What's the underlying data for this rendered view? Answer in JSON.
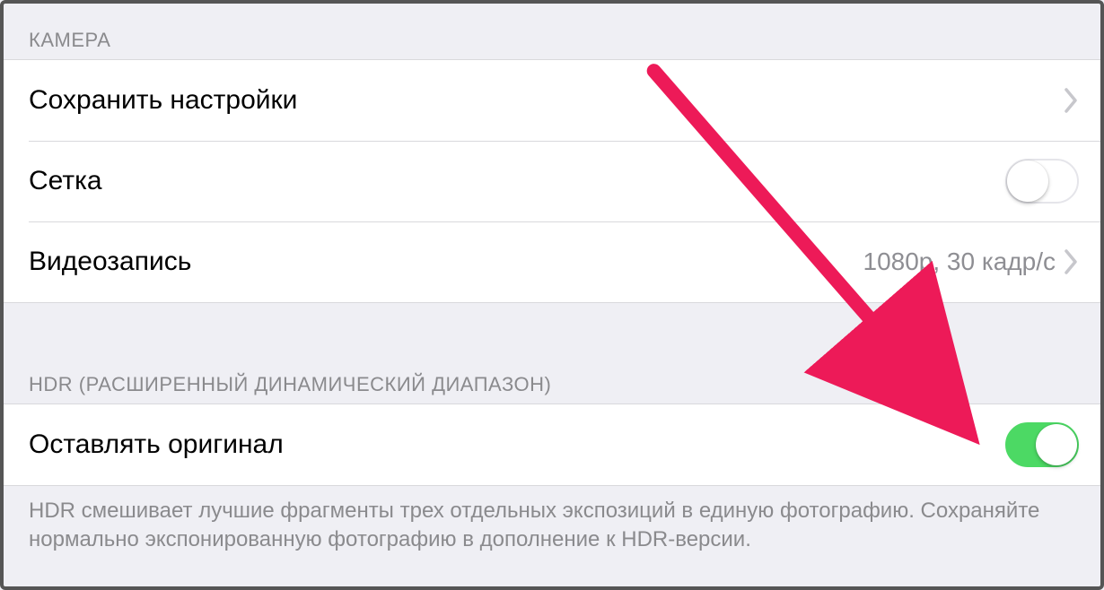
{
  "sections": {
    "camera": {
      "header": "КАМЕРА",
      "items": {
        "save_settings": {
          "label": "Сохранить настройки"
        },
        "grid": {
          "label": "Сетка",
          "on": false
        },
        "video": {
          "label": "Видеозапись",
          "value": "1080p, 30 кадр/с"
        }
      }
    },
    "hdr": {
      "header": "HDR (РАСШИРЕННЫЙ ДИНАМИЧЕСКИЙ ДИАПАЗОН)",
      "items": {
        "keep_original": {
          "label": "Оставлять оригинал",
          "on": true
        }
      },
      "footer": "HDR смешивает лучшие фрагменты трех отдельных экспозиций в единую фотографию. Сохраняйте нормально экспонированную фотографию в дополнение к HDR-версии."
    }
  },
  "colors": {
    "accent_arrow": "#ed1a58",
    "switch_on": "#4cd964"
  }
}
